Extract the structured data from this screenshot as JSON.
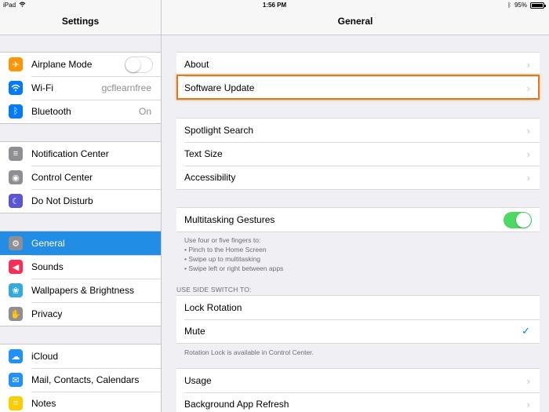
{
  "status_bar": {
    "device": "iPad",
    "time": "1:56 PM",
    "battery": "95%"
  },
  "left": {
    "title": "Settings",
    "group1": [
      {
        "label": "Airplane Mode",
        "icon": "airplane-icon",
        "color": "#ff9500",
        "glyph": "✈",
        "toggle": "off"
      },
      {
        "label": "Wi-Fi",
        "icon": "wifi-icon",
        "color": "#007aff",
        "glyph": "◠",
        "value": "gcflearnfree"
      },
      {
        "label": "Bluetooth",
        "icon": "bluetooth-icon",
        "color": "#007aff",
        "glyph": "ᛒ",
        "value": "On"
      }
    ],
    "group2": [
      {
        "label": "Notification Center",
        "icon": "notification-center-icon",
        "color": "#8e8e93",
        "glyph": "≡"
      },
      {
        "label": "Control Center",
        "icon": "control-center-icon",
        "color": "#8e8e93",
        "glyph": "◉"
      },
      {
        "label": "Do Not Disturb",
        "icon": "moon-icon",
        "color": "#5856d6",
        "glyph": "☾"
      }
    ],
    "group3": [
      {
        "label": "General",
        "icon": "gear-icon",
        "color": "#8e8e93",
        "glyph": "⚙",
        "selected": true
      },
      {
        "label": "Sounds",
        "icon": "speaker-icon",
        "color": "#ff2d55",
        "glyph": "◀"
      },
      {
        "label": "Wallpapers & Brightness",
        "icon": "flower-icon",
        "color": "#34aadc",
        "glyph": "❀"
      },
      {
        "label": "Privacy",
        "icon": "hand-icon",
        "color": "#8e8e93",
        "glyph": "✋"
      }
    ],
    "group4": [
      {
        "label": "iCloud",
        "icon": "cloud-icon",
        "color": "#1e90ff",
        "glyph": "☁"
      },
      {
        "label": "Mail, Contacts, Calendars",
        "icon": "mail-icon",
        "color": "#1e90ff",
        "glyph": "✉"
      },
      {
        "label": "Notes",
        "icon": "notes-icon",
        "color": "#ffcc00",
        "glyph": "≡"
      }
    ]
  },
  "right": {
    "title": "General",
    "group1": [
      "About",
      "Software Update"
    ],
    "group2": [
      "Spotlight Search",
      "Text Size",
      "Accessibility"
    ],
    "multitasking": {
      "label": "Multitasking Gestures",
      "toggle": "on"
    },
    "multitasking_note": [
      "Use four or five fingers to:",
      "• Pinch to the Home Screen",
      "• Swipe up to multitasking",
      "• Swipe left or right between apps"
    ],
    "side_switch_header": "USE SIDE SWITCH TO:",
    "side_switch": [
      {
        "label": "Lock Rotation",
        "checked": false
      },
      {
        "label": "Mute",
        "checked": true
      }
    ],
    "side_switch_note": "Rotation Lock is available in Control Center.",
    "group5": [
      "Usage",
      "Background App Refresh"
    ]
  },
  "colors": {
    "accent": "#007aff",
    "selected": "#218de5",
    "highlight": "#e07b17",
    "toggle_on": "#4cd964"
  }
}
